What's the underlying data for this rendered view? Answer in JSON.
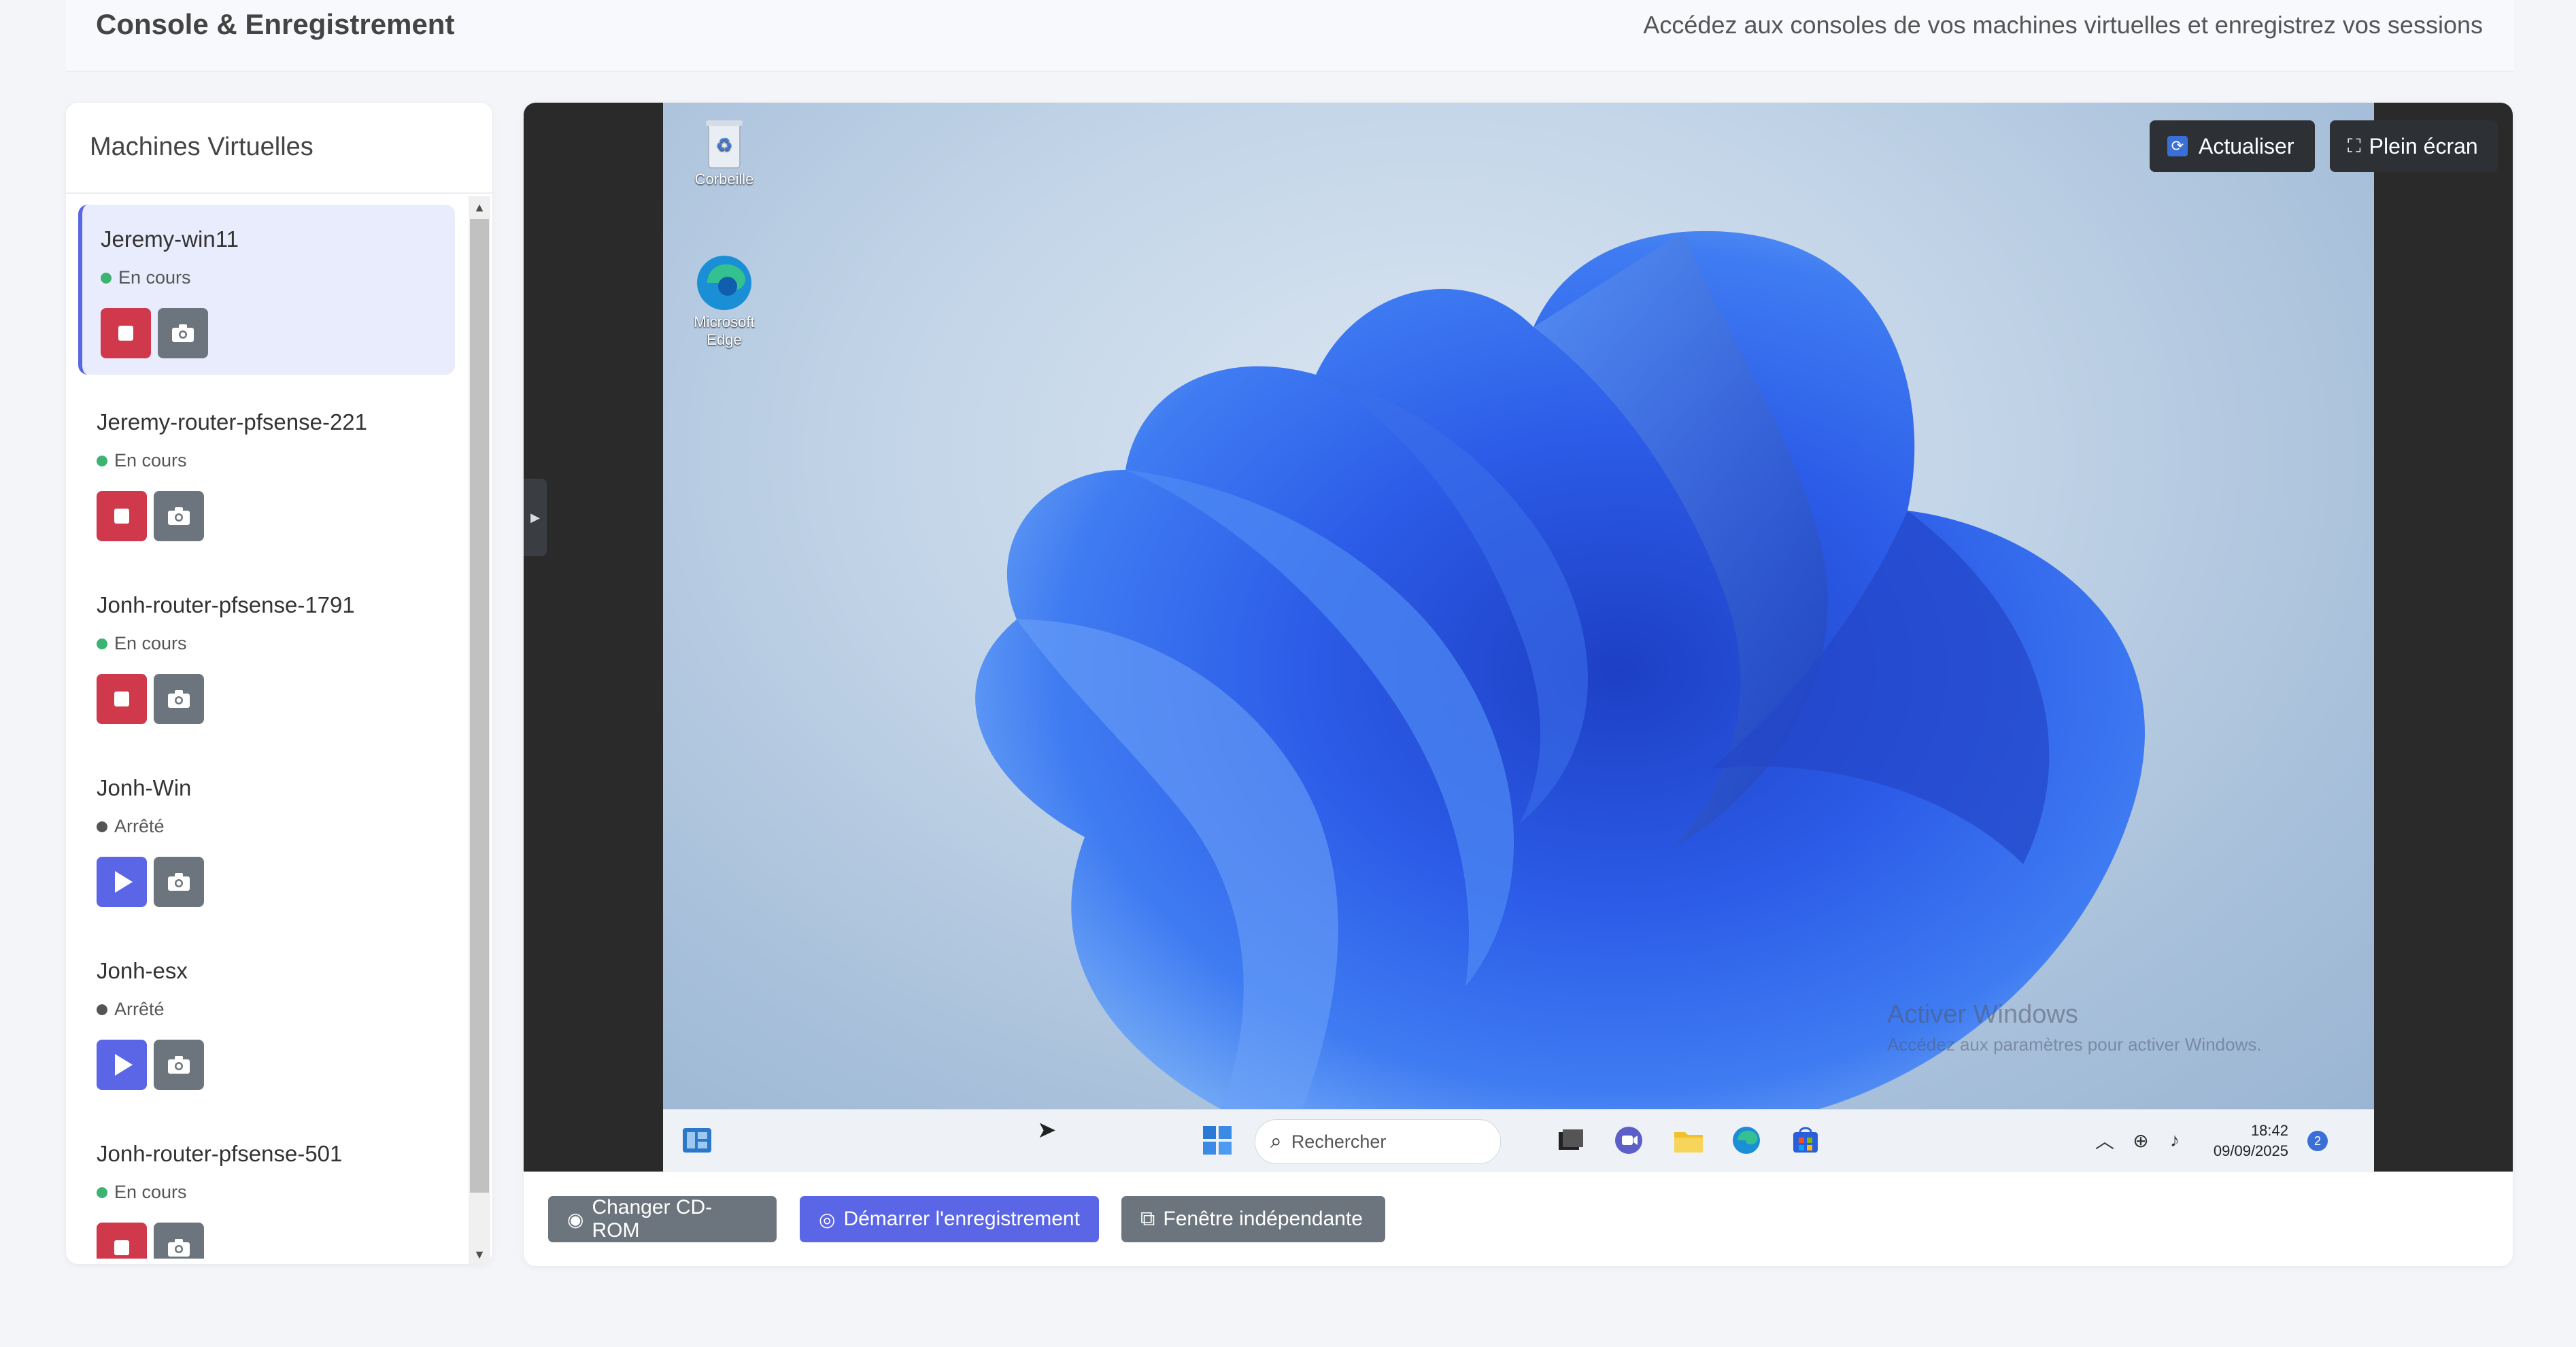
{
  "header": {
    "title": "Console & Enregistrement",
    "subtitle": "Accédez aux consoles de vos machines virtuelles et enregistrez vos sessions"
  },
  "sidebar": {
    "title": "Machines Virtuelles",
    "vms": [
      {
        "name": "Jeremy-win11",
        "status": "En cours",
        "running": true,
        "selected": true
      },
      {
        "name": "Jeremy-router-pfsense-221",
        "status": "En cours",
        "running": true
      },
      {
        "name": "Jonh-router-pfsense-1791",
        "status": "En cours",
        "running": true
      },
      {
        "name": "Jonh-Win",
        "status": "Arrêté",
        "running": false
      },
      {
        "name": "Jonh-esx",
        "status": "Arrêté",
        "running": false
      },
      {
        "name": "Jonh-router-pfsense-501",
        "status": "En cours",
        "running": true
      }
    ]
  },
  "console": {
    "refresh_label": "Actualiser",
    "fullscreen_label": "Plein écran",
    "desktop": {
      "icons": [
        "Corbeille",
        "Microsoft Edge"
      ],
      "watermark_title": "Activer Windows",
      "watermark_text": "Accédez aux paramètres pour activer Windows.",
      "search_placeholder": "Rechercher",
      "time": "18:42",
      "date": "09/09/2025",
      "notification_count": "2"
    }
  },
  "actions": {
    "cdrom_label": "Changer CD-ROM",
    "record_label": "Démarrer l'enregistrement",
    "window_label": "Fenêtre indépendante"
  },
  "colors": {
    "running": "#3cb371",
    "stopped": "#555555",
    "stop_button": "#d0384b",
    "start_button": "#5a66e6",
    "neutral_button": "#6c757d",
    "record_button": "#5a66e6"
  }
}
